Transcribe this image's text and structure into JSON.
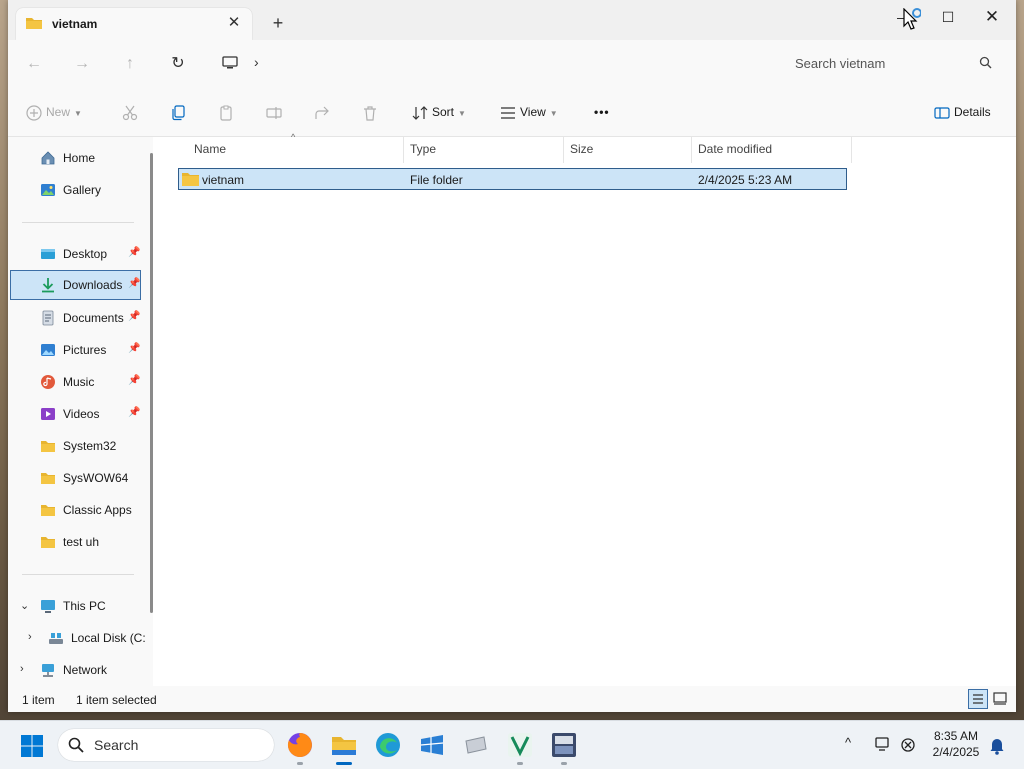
{
  "window": {
    "tab_title": "vietnam",
    "tab_close": "✕",
    "new_tab": "+",
    "controls": {
      "minimize": "—",
      "maximize": "☐",
      "close": "✕"
    }
  },
  "address": {
    "separator": "›",
    "search_placeholder": "Search vietnam"
  },
  "commands": {
    "new_label": "New",
    "sort_label": "Sort",
    "view_label": "View",
    "more_label": "•••",
    "details_label": "Details"
  },
  "sidebar": {
    "quick": [
      {
        "label": "Home",
        "icon": "home-icon"
      },
      {
        "label": "Gallery",
        "icon": "gallery-icon"
      }
    ],
    "pinned": [
      {
        "label": "Desktop",
        "icon": "desktop-icon",
        "pinned": true
      },
      {
        "label": "Downloads",
        "icon": "downloads-icon",
        "pinned": true,
        "selected": true
      },
      {
        "label": "Documents",
        "icon": "documents-icon",
        "pinned": true
      },
      {
        "label": "Pictures",
        "icon": "pictures-icon",
        "pinned": true
      },
      {
        "label": "Music",
        "icon": "music-icon",
        "pinned": true
      },
      {
        "label": "Videos",
        "icon": "videos-icon",
        "pinned": true
      },
      {
        "label": "System32",
        "icon": "folder-icon"
      },
      {
        "label": "SysWOW64",
        "icon": "folder-icon"
      },
      {
        "label": "Classic Apps",
        "icon": "folder-icon"
      },
      {
        "label": "test uh",
        "icon": "folder-icon"
      }
    ],
    "tree": [
      {
        "label": "This PC",
        "icon": "pc-icon",
        "expanded": true
      },
      {
        "label": "Local Disk (C:",
        "icon": "disk-icon"
      },
      {
        "label": "Network",
        "icon": "network-icon"
      }
    ]
  },
  "columns": {
    "name": "Name",
    "type": "Type",
    "size": "Size",
    "date": "Date modified"
  },
  "files": [
    {
      "name": "vietnam",
      "type": "File folder",
      "size": "",
      "date": "2/4/2025 5:23 AM",
      "selected": true
    }
  ],
  "status": {
    "count": "1 item",
    "selection": "1 item selected"
  },
  "taskbar": {
    "search_label": "Search",
    "time": "8:35 AM",
    "date": "2/4/2025"
  },
  "colors": {
    "selection_bg": "#cce4f7",
    "selection_border": "#2f5d8c",
    "folder_yellow": "#f4c542",
    "accent": "#0067c0"
  }
}
